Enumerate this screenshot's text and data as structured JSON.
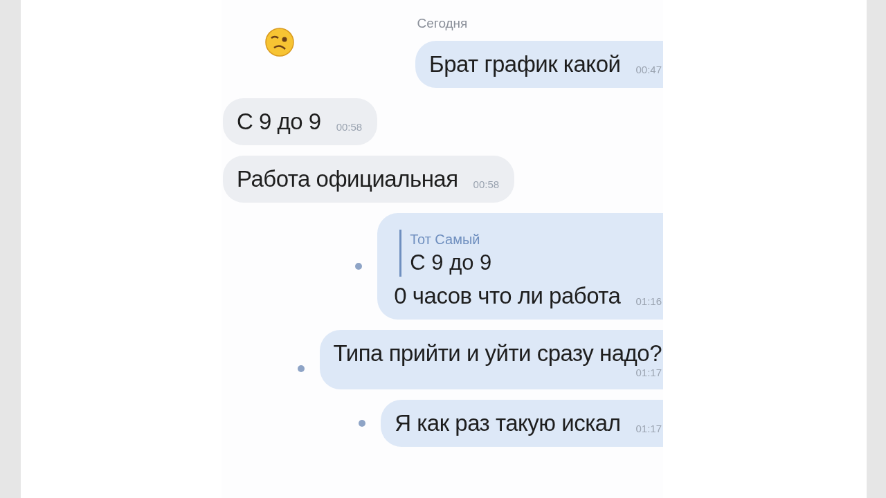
{
  "day_label": "Сегодня",
  "messages": [
    {
      "kind": "outgoing",
      "text": "Брат график какой",
      "time": "00:47",
      "unread": false,
      "time_below": false
    },
    {
      "kind": "incoming",
      "text": "С 9 до 9",
      "time": "00:58",
      "unread": false,
      "time_below": false
    },
    {
      "kind": "incoming",
      "text": "Работа официальная",
      "time": "00:58",
      "unread": false,
      "time_below": false
    },
    {
      "kind": "outgoing",
      "reply": {
        "author": "Тот Самый",
        "text": "С 9 до 9"
      },
      "text": "0 часов что ли работа",
      "time": "01:16",
      "unread": true,
      "time_below": false
    },
    {
      "kind": "outgoing",
      "text": "Типа прийти и уйти сразу надо?",
      "time": "01:17",
      "unread": true,
      "time_below": true
    },
    {
      "kind": "outgoing",
      "text": "Я как раз такую искал",
      "time": "01:17",
      "unread": true,
      "time_below": false
    }
  ]
}
